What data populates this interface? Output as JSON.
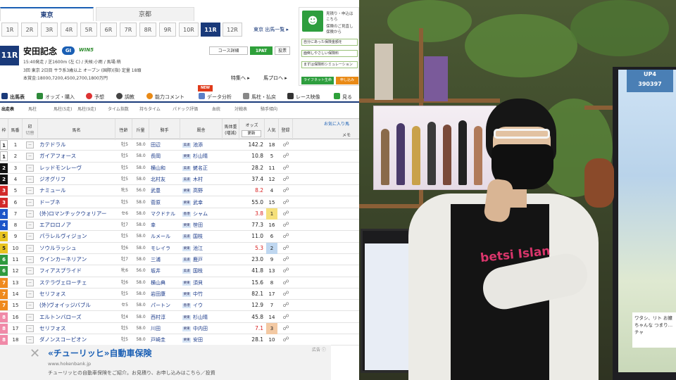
{
  "venues": [
    "東京",
    "京都"
  ],
  "races": [
    "1R",
    "2R",
    "3R",
    "4R",
    "5R",
    "6R",
    "7R",
    "8R",
    "9R",
    "10R",
    "11R",
    "12R"
  ],
  "active_race": "11R",
  "race_list_link": "東京 出馬一覧 ▸",
  "race": {
    "badge": "11R",
    "name": "安田記念",
    "grade": "GI",
    "win5": "WIN5",
    "line1": "15:40発走 / 芝1600m (左 C) / 天候:小雨  / 馬場:稍",
    "line2": "3回 東京 2日目 サラ系3歳以上 オープン      (国際)(指) 定量 18頭",
    "line3": "本賞金:18000,7200,4500,2700,1800万円",
    "course_btn": "コース詳細",
    "pat_btn": "1PAT",
    "vote_btn": "投票",
    "special_link": "特集へ ▸",
    "profile_link": "馬プロへ ▸"
  },
  "ad_top": {
    "lines": [
      "見積り・申込は",
      "こちら",
      "保険のご見直し",
      "保険から"
    ],
    "items": [
      "自分にあった保険金額を",
      "面倒しやさしい保険料",
      "まずは保険料シミュレーション"
    ],
    "btn1": "ライフネット生命",
    "btn2": "申し込み"
  },
  "tools": [
    "出馬表",
    "オッズ・購入",
    "予想",
    "調教",
    "能力コメント",
    "データ分析",
    "馬柱・払戻",
    "レース映像",
    "見る"
  ],
  "new_badge": "NEW",
  "subtabs": [
    "出走表",
    "馬柱",
    "馬柱(5走)",
    "馬柱(9走)",
    "タイム指数",
    "持ちタイム",
    "パドック評価",
    "血統",
    "対戦表",
    "騎手傾向"
  ],
  "table_head": {
    "frame": "枠",
    "num": "馬番",
    "mark": "印",
    "mark_sub": "切替",
    "name": "馬名",
    "sexage": "性齢",
    "weight_carried": "斤量",
    "jockey": "騎手",
    "trainer": "厩舎",
    "body_weight": "馬体重\n(増減)",
    "odds": "オッズ",
    "odds_sub": "更新",
    "pop": "人気",
    "reg": "登録",
    "fav": "お気に入り馬",
    "memo": "メモ"
  },
  "horses": [
    {
      "frame": "1",
      "num": "1",
      "name": "カテドラル",
      "sex": "牡5",
      "wt": "58.0",
      "jockey": "田辺",
      "area": "美浦",
      "trainer": "池添",
      "odds": "142.2",
      "pop": "18"
    },
    {
      "frame": "1",
      "num": "2",
      "name": "ガイアフォース",
      "sex": "牡5",
      "wt": "58.0",
      "jockey": "長岡",
      "area": "栗東",
      "trainer": "杉山晴",
      "odds": "10.8",
      "pop": "5"
    },
    {
      "frame": "2",
      "num": "3",
      "name": "レッドモンレーヴ",
      "sex": "牡5",
      "wt": "58.0",
      "jockey": "横山和",
      "area": "美浦",
      "trainer": "蛯名正",
      "odds": "28.2",
      "pop": "11"
    },
    {
      "frame": "2",
      "num": "4",
      "name": "ジオグリフ",
      "sex": "牡5",
      "wt": "58.0",
      "jockey": "北村友",
      "area": "美浦",
      "trainer": "木村",
      "odds": "37.4",
      "pop": "12"
    },
    {
      "frame": "3",
      "num": "5",
      "name": "ナミュール",
      "sex": "牝5",
      "wt": "56.0",
      "jockey": "武豊",
      "area": "栗東",
      "trainer": "高野",
      "odds": "8.2",
      "pop": "4"
    },
    {
      "frame": "3",
      "num": "6",
      "name": "ドーブネ",
      "sex": "牡5",
      "wt": "58.0",
      "jockey": "菅原",
      "area": "栗東",
      "trainer": "武幸",
      "odds": "55.0",
      "pop": "15"
    },
    {
      "frame": "4",
      "num": "7",
      "name": "(外)ロマンチックウォリアー",
      "sex": "セ6",
      "wt": "58.0",
      "jockey": "マクドナル",
      "area": "香港",
      "trainer": "シャム",
      "odds": "3.8",
      "pop": "1"
    },
    {
      "frame": "4",
      "num": "8",
      "name": "エアロロノア",
      "sex": "牡7",
      "wt": "58.0",
      "jockey": "幸",
      "area": "栗東",
      "trainer": "笹田",
      "odds": "77.3",
      "pop": "16"
    },
    {
      "frame": "5",
      "num": "9",
      "name": "パラレルヴィジョン",
      "sex": "牡5",
      "wt": "58.0",
      "jockey": "ルメール",
      "area": "美浦",
      "trainer": "国枝",
      "odds": "11.0",
      "pop": "6"
    },
    {
      "frame": "5",
      "num": "10",
      "name": "ソウルラッシュ",
      "sex": "牡6",
      "wt": "58.0",
      "jockey": "モレイラ",
      "area": "栗東",
      "trainer": "池江",
      "odds": "5.3",
      "pop": "2"
    },
    {
      "frame": "6",
      "num": "11",
      "name": "ウインカーネリアン",
      "sex": "牡7",
      "wt": "58.0",
      "jockey": "三浦",
      "area": "美浦",
      "trainer": "鹿戸",
      "odds": "23.0",
      "pop": "9"
    },
    {
      "frame": "6",
      "num": "12",
      "name": "フィアスプライド",
      "sex": "牝6",
      "wt": "56.0",
      "jockey": "坂井",
      "area": "美浦",
      "trainer": "国枝",
      "odds": "41.8",
      "pop": "13"
    },
    {
      "frame": "7",
      "num": "13",
      "name": "ステラヴェローチェ",
      "sex": "牡6",
      "wt": "58.0",
      "jockey": "横山典",
      "area": "栗東",
      "trainer": "須貝",
      "odds": "15.6",
      "pop": "8"
    },
    {
      "frame": "7",
      "num": "14",
      "name": "セリフォス",
      "sex": "牡5",
      "wt": "58.0",
      "jockey": "岩田康",
      "area": "栗東",
      "trainer": "中竹",
      "odds": "82.1",
      "pop": "17"
    },
    {
      "frame": "7",
      "num": "15",
      "name": "(外)ヴォイッジバブル",
      "sex": "セ5",
      "wt": "58.0",
      "jockey": "パートン",
      "area": "香港",
      "trainer": "イウ",
      "odds": "12.9",
      "pop": "7"
    },
    {
      "frame": "8",
      "num": "16",
      "name": "エルトンバローズ",
      "sex": "牡4",
      "wt": "58.0",
      "jockey": "西村淳",
      "area": "栗東",
      "trainer": "杉山晴",
      "odds": "45.8",
      "pop": "14"
    },
    {
      "frame": "8",
      "num": "17",
      "name": "セリフォス",
      "sex": "牡5",
      "wt": "58.0",
      "jockey": "川田",
      "area": "栗東",
      "trainer": "中内田",
      "odds": "7.1",
      "pop": "3"
    },
    {
      "frame": "8",
      "num": "18",
      "name": "ダノンスコーピオン",
      "sex": "牡5",
      "wt": "58.0",
      "jockey": "戸崎圭",
      "area": "栗東",
      "trainer": "安田",
      "odds": "28.1",
      "pop": "10"
    }
  ],
  "bottom_ad": {
    "title": "«チューリッヒ»自動車保険",
    "url": "www.hokenbank.jp",
    "desc": "チューリッヒの自動車保険をご紹介。お見積り、お申し込みはこちら／投資",
    "tag": "広告 ⓘ"
  },
  "stream": {
    "game_score": "390397",
    "game_label": "UP4",
    "dialog": "ワタシ、リト お嬢ちゃんな つまり…チャ",
    "shirt_text": "betsi Islan"
  },
  "colors": {
    "frame": [
      "#ffffff",
      "#111111",
      "#d22a2a",
      "#1d56c9",
      "#e8c31e",
      "#2f9a3e",
      "#ef8a1e",
      "#f08aa8"
    ],
    "brand_blue": "#1a3a7a",
    "odds_hot": "#d92020"
  }
}
